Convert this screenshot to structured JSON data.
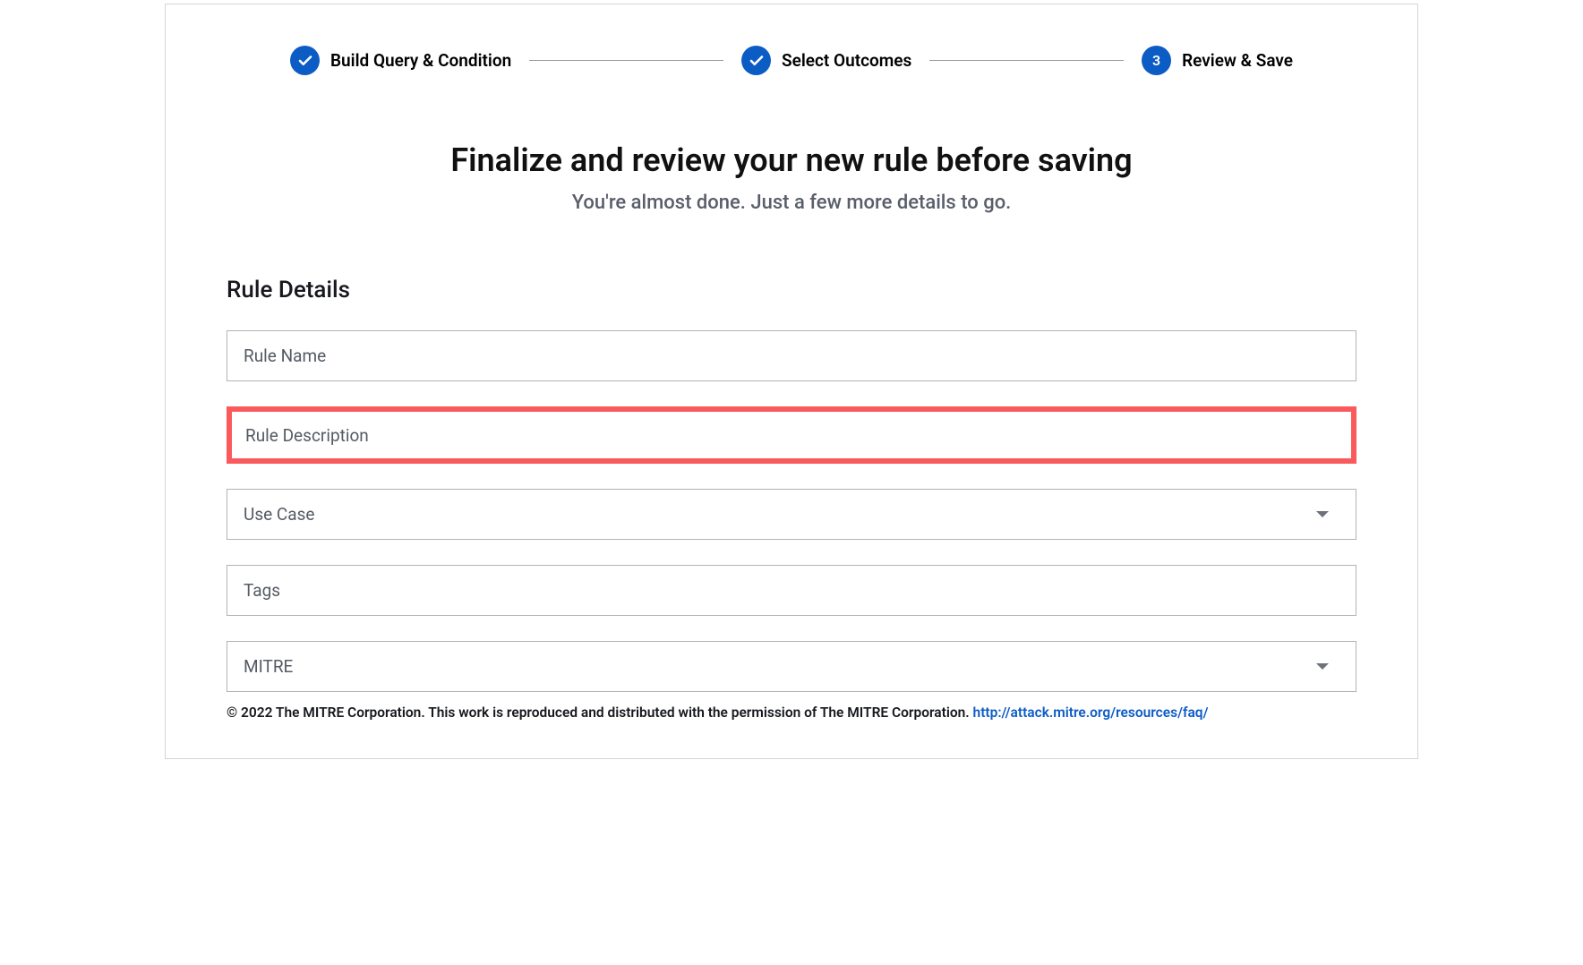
{
  "stepper": {
    "steps": [
      {
        "label": "Build Query & Condition",
        "state": "done"
      },
      {
        "label": "Select Outcomes",
        "state": "done"
      },
      {
        "label": "Review & Save",
        "state": "active",
        "number": "3"
      }
    ]
  },
  "heading": {
    "title": "Finalize and review your new rule before saving",
    "subtitle": "You're almost done. Just a few more details to go."
  },
  "section": {
    "title": "Rule Details"
  },
  "fields": {
    "ruleName": {
      "label": "Rule Name"
    },
    "ruleDescription": {
      "label": "Rule Description"
    },
    "useCase": {
      "label": "Use Case"
    },
    "tags": {
      "label": "Tags"
    },
    "mitre": {
      "label": "MITRE"
    }
  },
  "footer": {
    "prefix": "© 2022 The MITRE Corporation. This work is reproduced and distributed with the permission of The MITRE Corporation. ",
    "linkText": "http://attack.mitre.org/resources/faq/"
  }
}
